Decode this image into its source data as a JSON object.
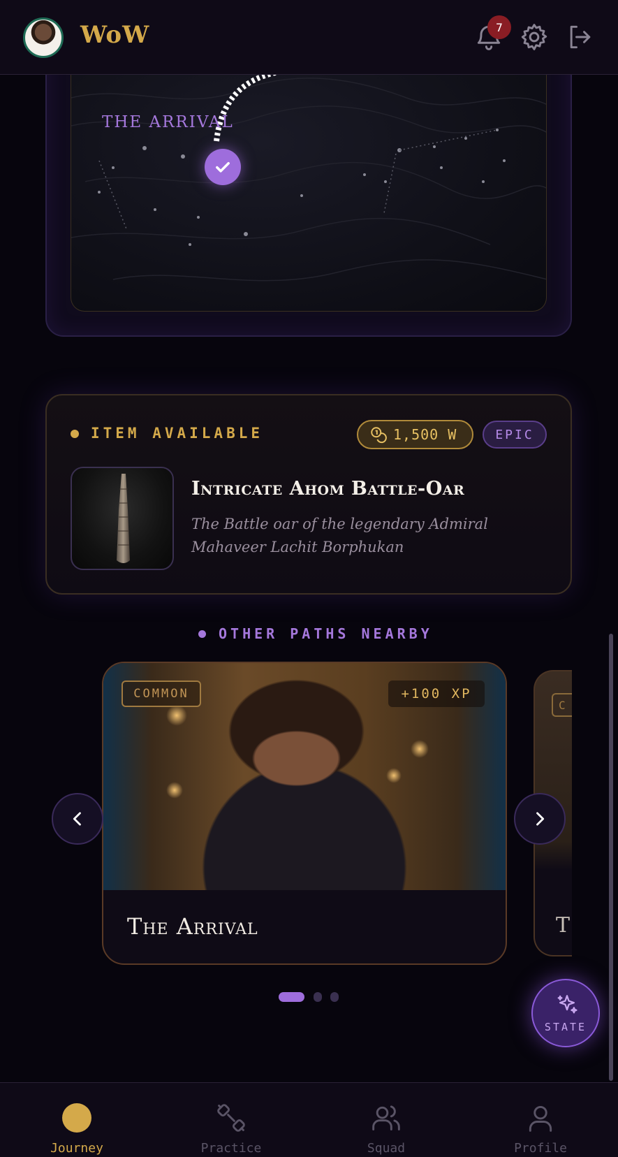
{
  "header": {
    "brand": "WoW",
    "notification_count": "7",
    "icons": [
      "bell-icon",
      "gear-icon",
      "logout-icon"
    ]
  },
  "map": {
    "label": "THE ARRIVAL",
    "node_status": "completed"
  },
  "item": {
    "status_label": "ITEM AVAILABLE",
    "price": "1,500 W",
    "rarity": "EPIC",
    "title": "Intricate Ahom Battle-Oar",
    "description": "The Battle oar of the legendary Admiral Mahaveer Lachit Borphukan"
  },
  "other_paths": {
    "heading": "OTHER PATHS NEARBY",
    "cards": [
      {
        "rarity": "COMMON",
        "xp": "+100 XP",
        "title": "The Arrival"
      },
      {
        "rarity": "C",
        "title": "T"
      }
    ],
    "pagination": {
      "total": 3,
      "active": 1
    }
  },
  "fab": {
    "label": "STATE"
  },
  "bottom_nav": {
    "tabs": [
      {
        "label": "Journey",
        "active": true
      },
      {
        "label": "Practice",
        "active": false
      },
      {
        "label": "Squad",
        "active": false
      },
      {
        "label": "Profile",
        "active": false
      }
    ]
  },
  "colors": {
    "background": "#07050d",
    "gold_accent": "#d4a94a",
    "purple_accent": "#a578dc",
    "badge_red": "#8a1d24"
  }
}
